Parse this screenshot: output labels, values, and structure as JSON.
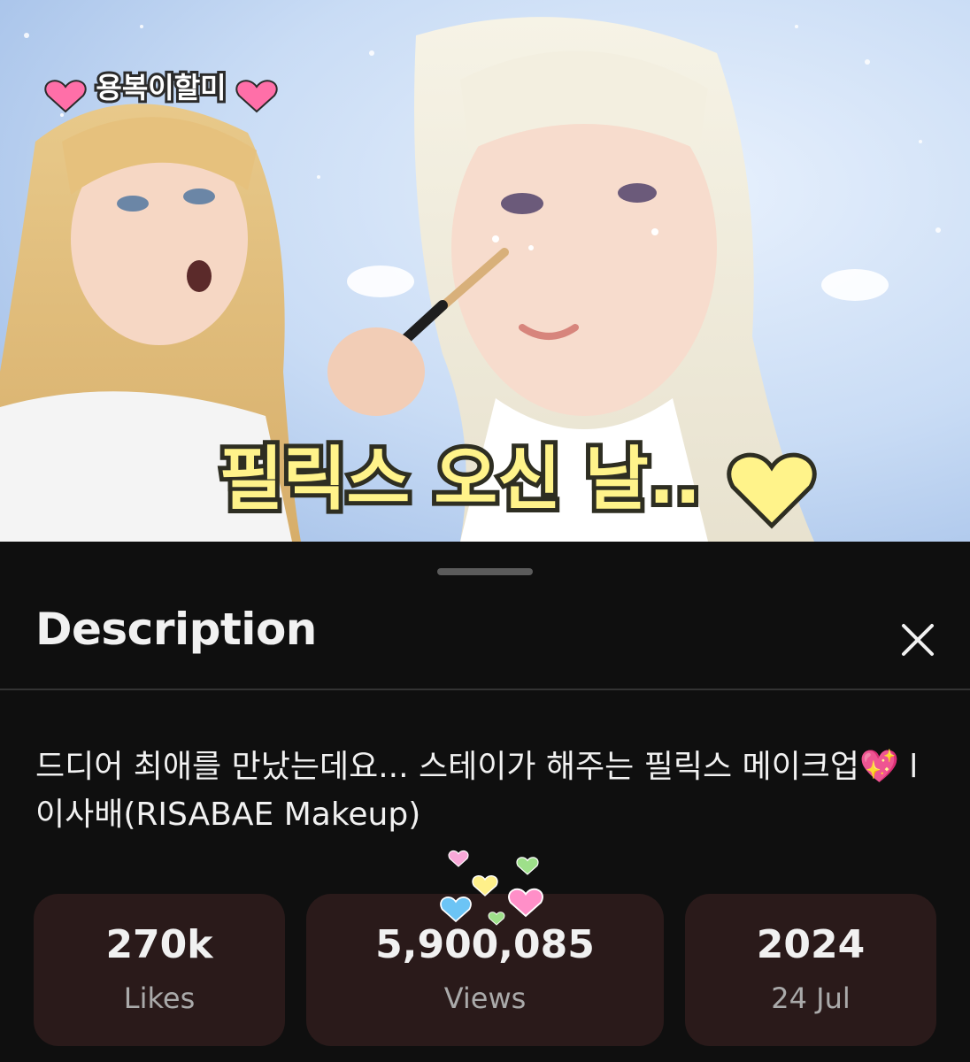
{
  "thumbnail": {
    "badge_text": "용복이할미",
    "caption_text": "필릭스 오신 날..",
    "colors": {
      "sky": "#cfe1f7",
      "caption_fill": "#fff38a",
      "caption_stroke": "#3a3a2a",
      "badge_heart": "#ff6fa8"
    }
  },
  "sheet": {
    "heading": "Description",
    "close_icon": "close-icon",
    "video_title": "드디어 최애를 만났는데요... 스테이가 해주는 필릭스 메이크업💖 l 이사배(RISABAE Makeup)",
    "stats": [
      {
        "value": "270k",
        "label": "Likes"
      },
      {
        "value": "5,900,085",
        "label": "Views"
      },
      {
        "value": "2024",
        "label": "24 Jul"
      }
    ],
    "decor_hearts": [
      "pink-heart",
      "green-heart",
      "yellow-heart",
      "blue-heart",
      "green-heart",
      "pink-heart"
    ],
    "colors": {
      "background": "#0f0f0f",
      "card": "#2a1a1a",
      "text": "#f1f1f1",
      "muted": "#aaaaaa"
    }
  }
}
